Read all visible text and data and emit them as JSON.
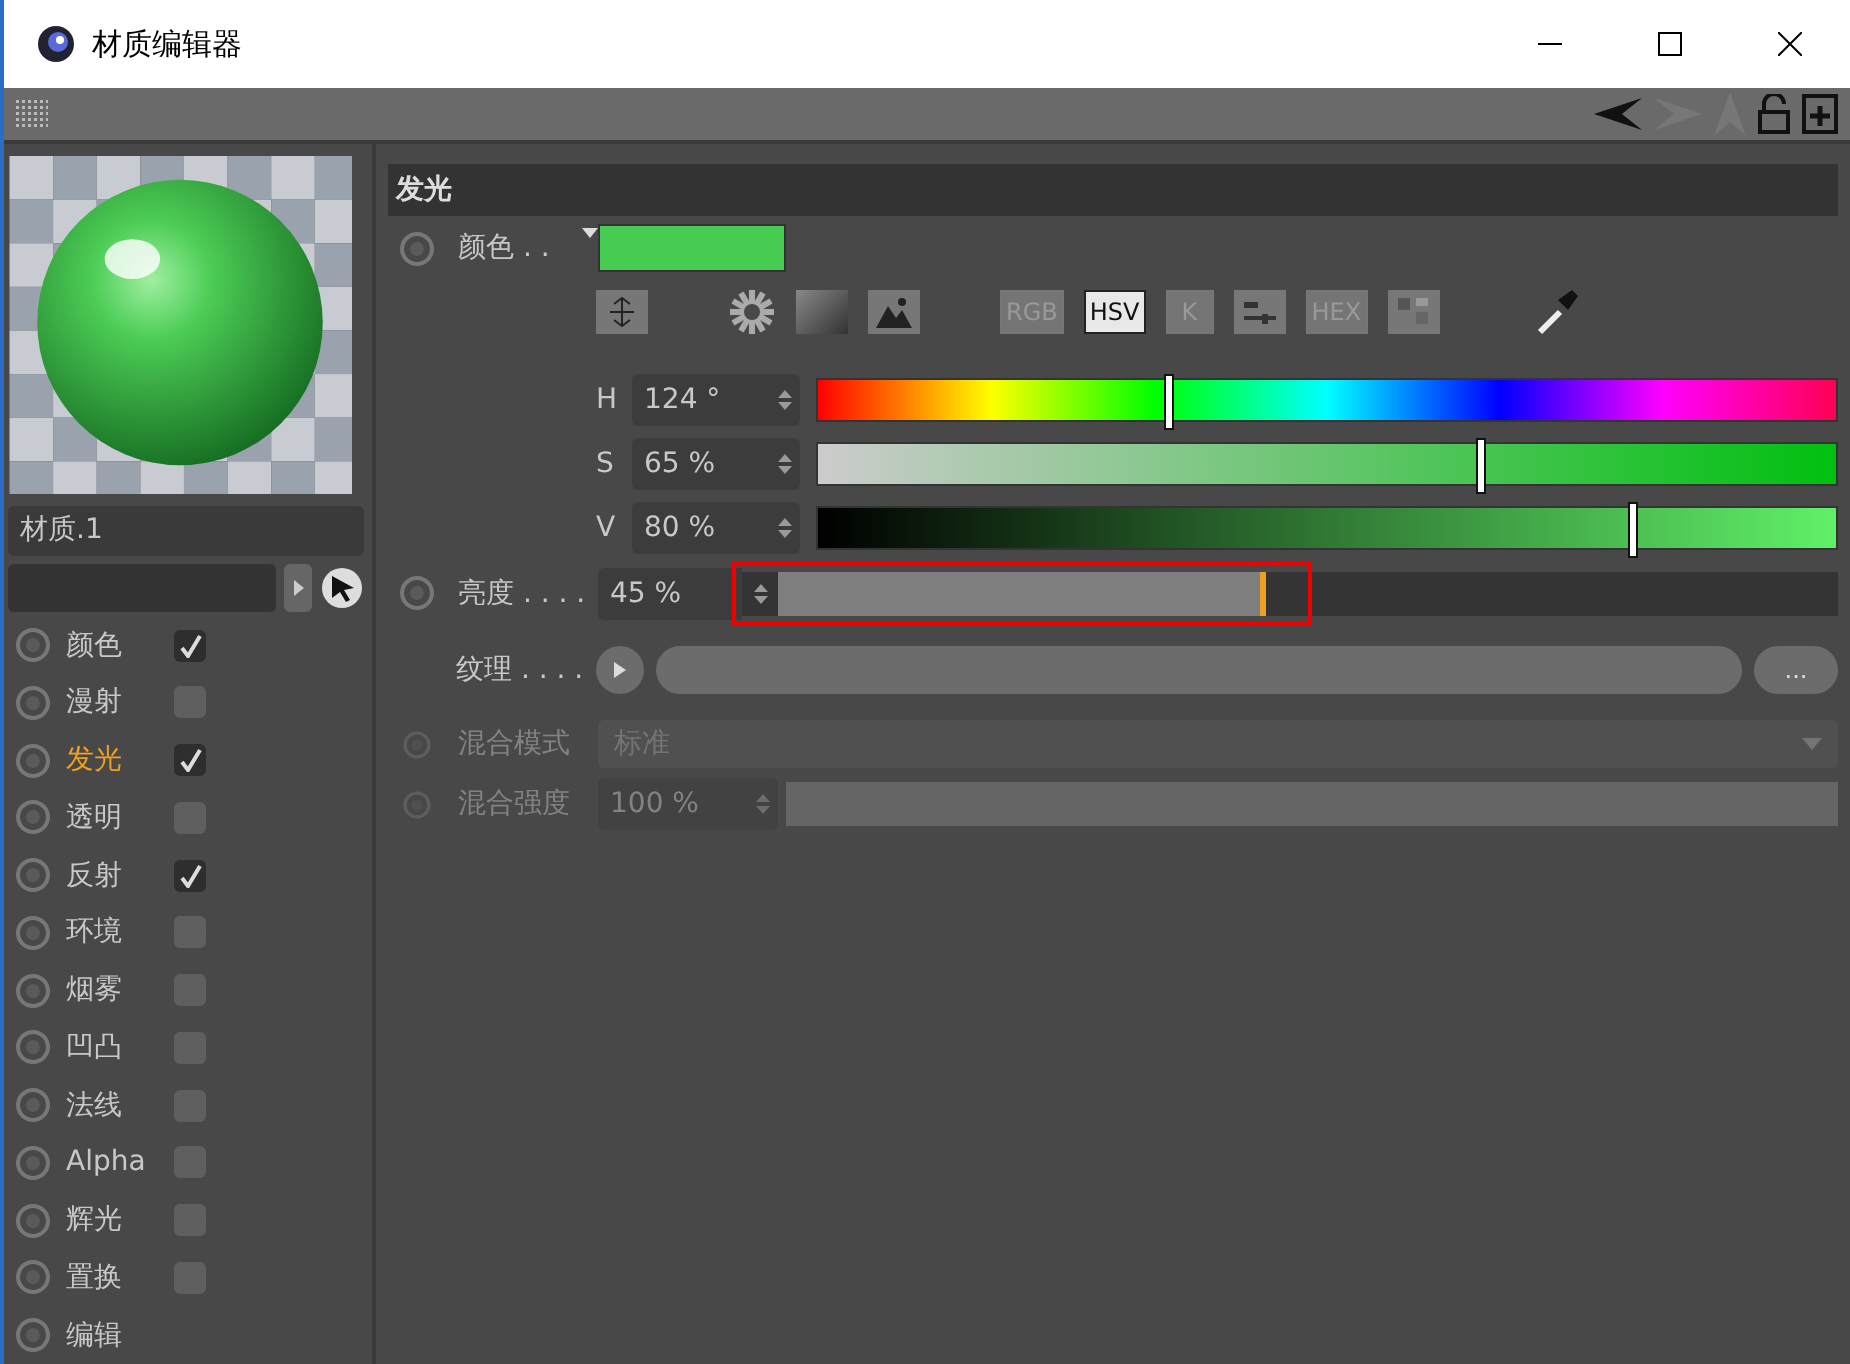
{
  "window": {
    "title": "材质编辑器"
  },
  "material": {
    "name": "材质.1"
  },
  "channels": [
    {
      "kind": "toggle",
      "name": "颜色",
      "checked": true,
      "selected": false
    },
    {
      "kind": "toggle",
      "name": "漫射",
      "checked": false,
      "selected": false
    },
    {
      "kind": "toggle",
      "name": "发光",
      "checked": true,
      "selected": true
    },
    {
      "kind": "toggle",
      "name": "透明",
      "checked": false,
      "selected": false
    },
    {
      "kind": "toggle",
      "name": "反射",
      "checked": true,
      "selected": false
    },
    {
      "kind": "toggle",
      "name": "环境",
      "checked": false,
      "selected": false
    },
    {
      "kind": "toggle",
      "name": "烟雾",
      "checked": false,
      "selected": false
    },
    {
      "kind": "toggle",
      "name": "凹凸",
      "checked": false,
      "selected": false
    },
    {
      "kind": "toggle",
      "name": "法线",
      "checked": false,
      "selected": false
    },
    {
      "kind": "toggle",
      "name": "Alpha",
      "checked": false,
      "selected": false
    },
    {
      "kind": "toggle",
      "name": "辉光",
      "checked": false,
      "selected": false
    },
    {
      "kind": "toggle",
      "name": "置换",
      "checked": false,
      "selected": false
    },
    {
      "kind": "label",
      "name": "编辑"
    }
  ],
  "section": {
    "title": "发光"
  },
  "color": {
    "label": "颜色 . ."
  },
  "color_modes": [
    {
      "label": "RGB",
      "selected": false
    },
    {
      "label": "HSV",
      "selected": true
    },
    {
      "label": "K",
      "selected": false
    },
    {
      "label": "HEX",
      "selected": false
    }
  ],
  "hsv": [
    {
      "kind": "hue",
      "label": "H",
      "value": "124 °",
      "level": 0.344
    },
    {
      "kind": "saturation",
      "label": "S",
      "value": "65 %",
      "level": 0.65
    },
    {
      "kind": "value",
      "label": "V",
      "value": "80 %",
      "level": 0.8
    }
  ],
  "brightness": {
    "label": "亮度 . . . .",
    "value": "45 %",
    "level": 0.46
  },
  "texture": {
    "label": "纹理 . . . .",
    "button": "..."
  },
  "blend_mode": {
    "label": "混合模式",
    "value": "标准",
    "disabled": true
  },
  "blend_strength": {
    "label": "混合强度",
    "value": "100 %",
    "level": 1,
    "disabled": true
  }
}
